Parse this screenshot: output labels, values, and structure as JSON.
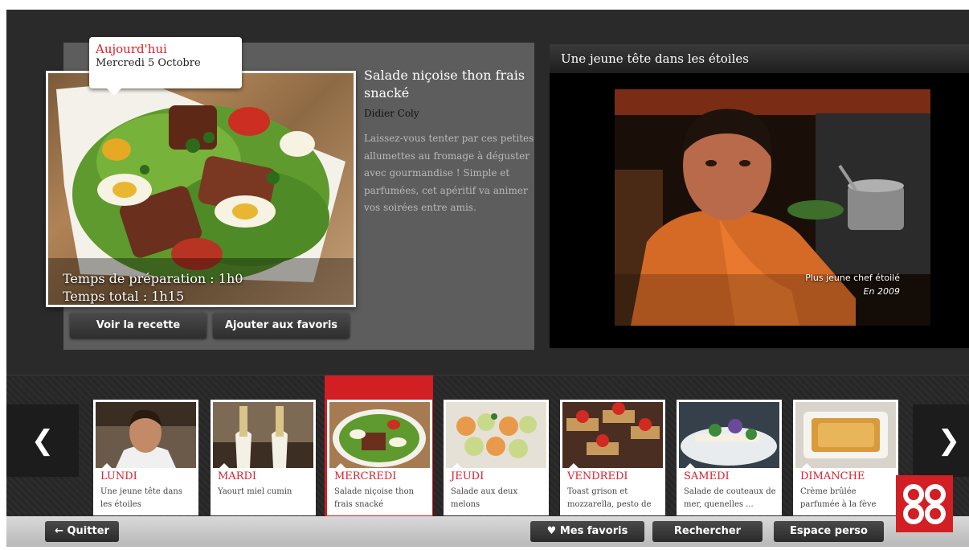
{
  "today": {
    "label": "Aujourd'hui",
    "date": "Mercredi 5 Octobre"
  },
  "recipe": {
    "title": "Salade niçoise thon frais snacké",
    "author": "Didier Coly",
    "description": "Laissez-vous tenter par ces petites allumettes au fromage à déguster avec gourmandise ! Simple et parfumées, cet apéritif va animer vos soirées entre amis.",
    "prep_time": "Temps de préparation : 1h0",
    "total_time": "Temps total : 1h15",
    "view_button": "Voir la recette",
    "favorite_button": "Ajouter aux favoris"
  },
  "video": {
    "title": "Une jeune tête dans les étoiles",
    "caption_line1": "Plus jeune chef étoilé",
    "caption_line2": "En 2009"
  },
  "week": {
    "days": [
      {
        "day": "LUNDI",
        "dish": "Une jeune tête dans les étoiles"
      },
      {
        "day": "MARDI",
        "dish": "Yaourt miel cumin"
      },
      {
        "day": "MERCREDI",
        "dish": "Salade niçoise thon frais snacké"
      },
      {
        "day": "JEUDI",
        "dish": "Salade aux deux melons"
      },
      {
        "day": "VENDREDI",
        "dish": "Toast grison et mozzarella, pesto de"
      },
      {
        "day": "SAMEDI",
        "dish": "Salade de couteaux de mer, quenelles ..."
      },
      {
        "day": "DIMANCHE",
        "dish": "Crème brûlée parfumée à la fève"
      }
    ],
    "active_index": 2
  },
  "footer": {
    "quit": "Quitter",
    "favorites": "Mes favoris",
    "search": "Rechercher",
    "personal_space": "Espace perso"
  },
  "colors": {
    "accent": "#d11f24",
    "panel": "#5d5d5d",
    "background": "#2a2a2a"
  },
  "icons": [
    "arrow-left-icon",
    "chevron-left-icon",
    "chevron-right-icon",
    "heart-icon",
    "logo-icon"
  ]
}
